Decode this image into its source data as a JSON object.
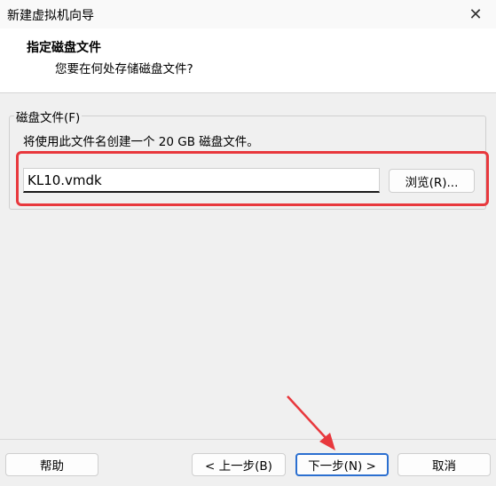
{
  "window": {
    "title": "新建虚拟机向导",
    "close_glyph": "✕"
  },
  "header": {
    "title": "指定磁盘文件",
    "subtitle": "您要在何处存储磁盘文件?"
  },
  "disk_file_group": {
    "legend": "磁盘文件(F)",
    "description": "将使用此文件名创建一个 20 GB 磁盘文件。",
    "filename_value": "KL10.vmdk",
    "browse_label": "浏览(R)..."
  },
  "footer": {
    "help_label": "帮助",
    "back_label": "< 上一步(B)",
    "next_label": "下一步(N) >",
    "cancel_label": "取消"
  },
  "colors": {
    "highlight_red": "#e8383d",
    "default_button_border": "#2b6fd0"
  },
  "icons": {
    "close": "close-icon",
    "annotation_arrow": "red-arrow-icon"
  }
}
